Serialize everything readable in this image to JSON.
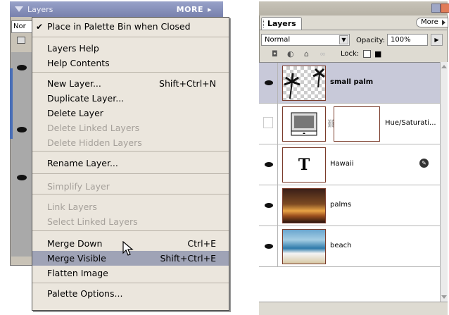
{
  "left_panel": {
    "title": "Layers",
    "more_label": "MORE",
    "more_arrow": "▸",
    "blend_mode_partial": "Nor",
    "menu": {
      "checkmark": "✔",
      "items": [
        {
          "label": "Place in Palette Bin when Closed",
          "shortcut": "",
          "checked": true,
          "disabled": false
        },
        {
          "label": "Layers Help",
          "shortcut": "",
          "disabled": false
        },
        {
          "label": "Help Contents",
          "shortcut": "",
          "disabled": false
        },
        {
          "label": "New Layer...",
          "shortcut": "Shift+Ctrl+N",
          "disabled": false
        },
        {
          "label": "Duplicate Layer...",
          "shortcut": "",
          "disabled": false
        },
        {
          "label": "Delete Layer",
          "shortcut": "",
          "disabled": false
        },
        {
          "label": "Delete Linked Layers",
          "shortcut": "",
          "disabled": true
        },
        {
          "label": "Delete Hidden Layers",
          "shortcut": "",
          "disabled": true
        },
        {
          "label": "Rename Layer...",
          "shortcut": "",
          "disabled": false
        },
        {
          "label": "Simplify Layer",
          "shortcut": "",
          "disabled": true
        },
        {
          "label": "Link Layers",
          "shortcut": "",
          "disabled": true
        },
        {
          "label": "Select Linked Layers",
          "shortcut": "",
          "disabled": true
        },
        {
          "label": "Merge Down",
          "shortcut": "Ctrl+E",
          "disabled": false
        },
        {
          "label": "Merge Visible",
          "shortcut": "Shift+Ctrl+E",
          "disabled": false,
          "highlighted": true
        },
        {
          "label": "Flatten Image",
          "shortcut": "",
          "disabled": false
        },
        {
          "label": "Palette Options...",
          "shortcut": "",
          "disabled": false
        }
      ]
    }
  },
  "right_panel": {
    "tab_label": "Layers",
    "more_label": "More",
    "blend_mode": "Normal",
    "opacity_label": "Opacity:",
    "opacity_value": "100%",
    "lock_label": "Lock:",
    "layers": [
      {
        "name": "small palm",
        "visible": true,
        "selected": true,
        "thumb": "checker-palm",
        "bold": true
      },
      {
        "name": "Hue/Saturati...",
        "visible": false,
        "selected": false,
        "thumb": "adjustment",
        "bold": false
      },
      {
        "name": "Hawaii",
        "visible": true,
        "selected": false,
        "thumb": "text",
        "thumb_glyph": "T",
        "bold": false
      },
      {
        "name": "palms",
        "visible": true,
        "selected": false,
        "thumb": "palms",
        "bold": false
      },
      {
        "name": "beach",
        "visible": true,
        "selected": false,
        "thumb": "beach",
        "bold": false
      }
    ]
  },
  "colors": {
    "menu_bg": "#ebe6dd",
    "menu_highlight": "#9fa3b6",
    "selected_row": "#c8c9d9",
    "thumb_border": "#7a3b2a",
    "titlebar": "#7881ad"
  }
}
